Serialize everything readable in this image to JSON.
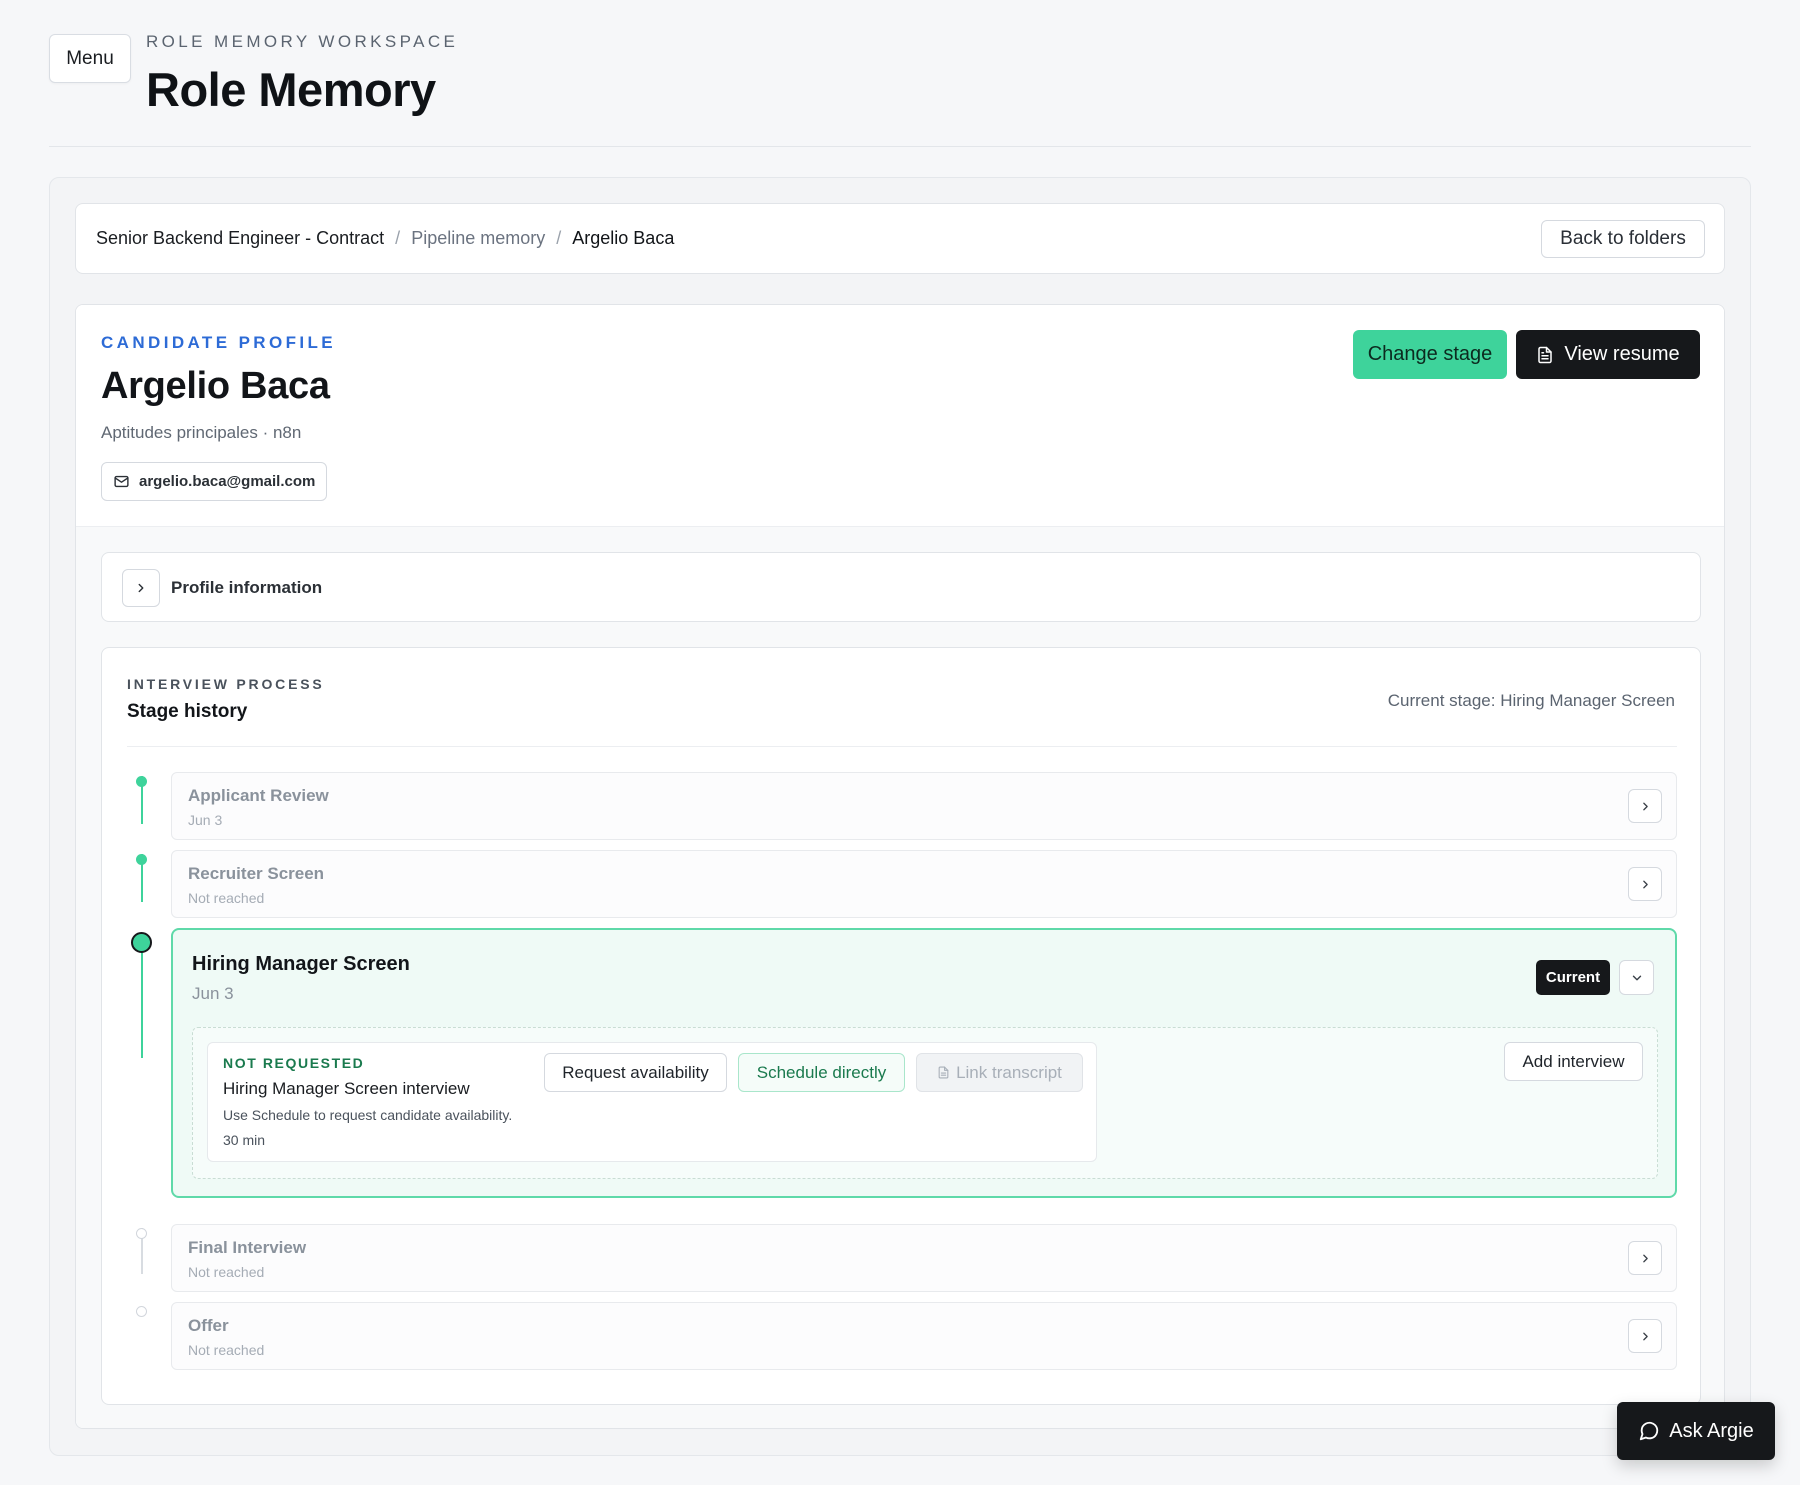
{
  "header": {
    "menu_label": "Menu",
    "eyebrow": "ROLE MEMORY WORKSPACE",
    "title": "Role Memory"
  },
  "breadcrumb": {
    "items": [
      "Senior Backend Engineer - Contract",
      "Pipeline memory",
      "Argelio Baca"
    ],
    "separator": "/",
    "back_label": "Back to folders"
  },
  "candidate": {
    "eyebrow": "CANDIDATE PROFILE",
    "name": "Argelio Baca",
    "subtitle": "Aptitudes principales · n8n",
    "email": "argelio.baca@gmail.com",
    "change_stage_label": "Change stage",
    "view_resume_label": "View resume"
  },
  "profile_info": {
    "label": "Profile information"
  },
  "process": {
    "eyebrow": "INTERVIEW PROCESS",
    "title": "Stage history",
    "current_stage_text": "Current stage: Hiring Manager Screen",
    "stages": [
      {
        "name": "Applicant Review",
        "date": "Jun 3",
        "state": "done"
      },
      {
        "name": "Recruiter Screen",
        "date": "Not reached",
        "state": "done"
      },
      {
        "name": "Hiring Manager Screen",
        "date": "Jun 3",
        "state": "current"
      },
      {
        "name": "Final Interview",
        "date": "Not reached",
        "state": "pending"
      },
      {
        "name": "Offer",
        "date": "Not reached",
        "state": "pending"
      }
    ],
    "current_badge": "Current",
    "interview": {
      "status": "NOT REQUESTED",
      "title": "Hiring Manager Screen interview",
      "description": "Use Schedule to request candidate availability.",
      "duration": "30 min",
      "request_label": "Request availability",
      "schedule_label": "Schedule directly",
      "transcript_label": "Link transcript",
      "add_label": "Add interview"
    }
  },
  "assistant": {
    "label": "Ask Argie"
  },
  "colors": {
    "accent_green": "#3ed39b",
    "dark": "#16181b",
    "link_blue": "#2d6bd6"
  }
}
